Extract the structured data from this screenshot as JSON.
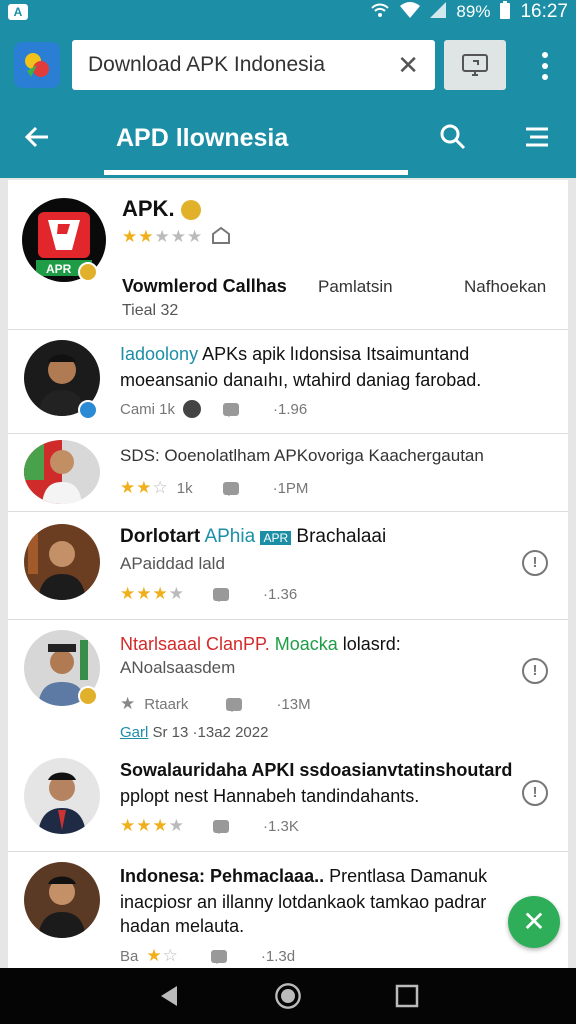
{
  "status_bar": {
    "battery": "89%",
    "time": "16:27",
    "left_icon": "app-notification-icon"
  },
  "browser": {
    "search_text": "Download APK Indonesia",
    "clear_icon": "close-icon",
    "cast_icon": "cast-icon",
    "menu_icon": "more-vert-icon"
  },
  "tab_bar": {
    "title": "APD llownesia",
    "back_icon": "arrow-back-icon",
    "search_icon": "search-icon",
    "filter_icon": "filter-icon"
  },
  "featured": {
    "name": "APK.",
    "rating": 2,
    "col1": "Vowmlerod Callhas",
    "col2": "Pamlatsin",
    "col3": "Nafhoekan",
    "footer": "Tieal 32"
  },
  "items": [
    {
      "title_colored": "Iadoolony",
      "title_rest": " APKs apik lıdonsisa Itsaimuntand",
      "title_line2": "moeansanio danaıhı, wtahird daniag farobad.",
      "meta_left": "Cami 1k",
      "meta_count": "·1.96"
    },
    {
      "title": "SDS: Ooenolatlham APKovoriga Kaachergautan",
      "rating_text": "1k",
      "meta_count": "·1PM"
    },
    {
      "title_bold": "Dorlotart",
      "title_colored": " APhia ",
      "title_tag": "APR",
      "title_rest": " Brachalaai",
      "sub": "APaiddad lald",
      "meta_count": "·1.36"
    },
    {
      "title_red": "Ntarlsaaal ClanPP.",
      "title_green": " Moacka",
      "title_rest": " lolasrd:",
      "sub": "ANoalsaasdem",
      "rating_text": "Rtaark",
      "meta_count": "·13M",
      "tag_line_colored": "Garl",
      "tag_line_rest": " Sr 13 ·13a2  2022"
    },
    {
      "title_line1": "Sowalauridaha APKI ssdoasianvtatinshoutard",
      "title_line2": "pplopt nest Hannabeh tandindahants.",
      "meta_count": "·1.3K"
    },
    {
      "title_bold": "Indonesa: Pehmaclaaa..",
      "title_rest": " Prentlasa Damanuk",
      "line2": "inacpiosr an illanny lotdankaok tamkao padrar",
      "line3": "hadan melauta.",
      "meta_left": "Ba",
      "meta_count": "·1.3d"
    }
  ],
  "fab_icon": "check-icon",
  "nav": {
    "back": "back-triangle-icon",
    "home": "home-circle-icon",
    "recents": "recents-square-icon"
  },
  "colors": {
    "primary": "#1c8ea6",
    "accent_green": "#2fae5a",
    "star": "#f0b01c"
  }
}
